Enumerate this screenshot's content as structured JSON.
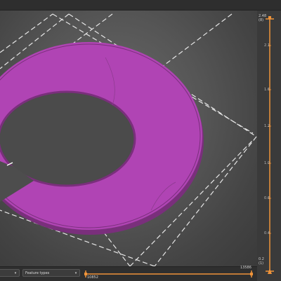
{
  "colors": {
    "part": "#b044b4",
    "part_edge": "#7a2f7c",
    "accent": "#f0943a",
    "background": "#3a3a3a"
  },
  "vertical_slider": {
    "top_value": "2.48",
    "top_layer": "(8)",
    "bottom_value": "0.2",
    "bottom_layer": "(1)",
    "ticks": [
      "2.1",
      "1.6",
      "1.2",
      "1.0",
      "0.6",
      "0.4"
    ]
  },
  "horizontal_slider": {
    "left_value": "10852",
    "right_value": "13586"
  },
  "bottom_bar": {
    "view_select": "",
    "feature_types_label": "Feature types"
  },
  "icons": {
    "dropdown": "chevron-down-icon",
    "slider_handle": "up-arrow-icon"
  }
}
